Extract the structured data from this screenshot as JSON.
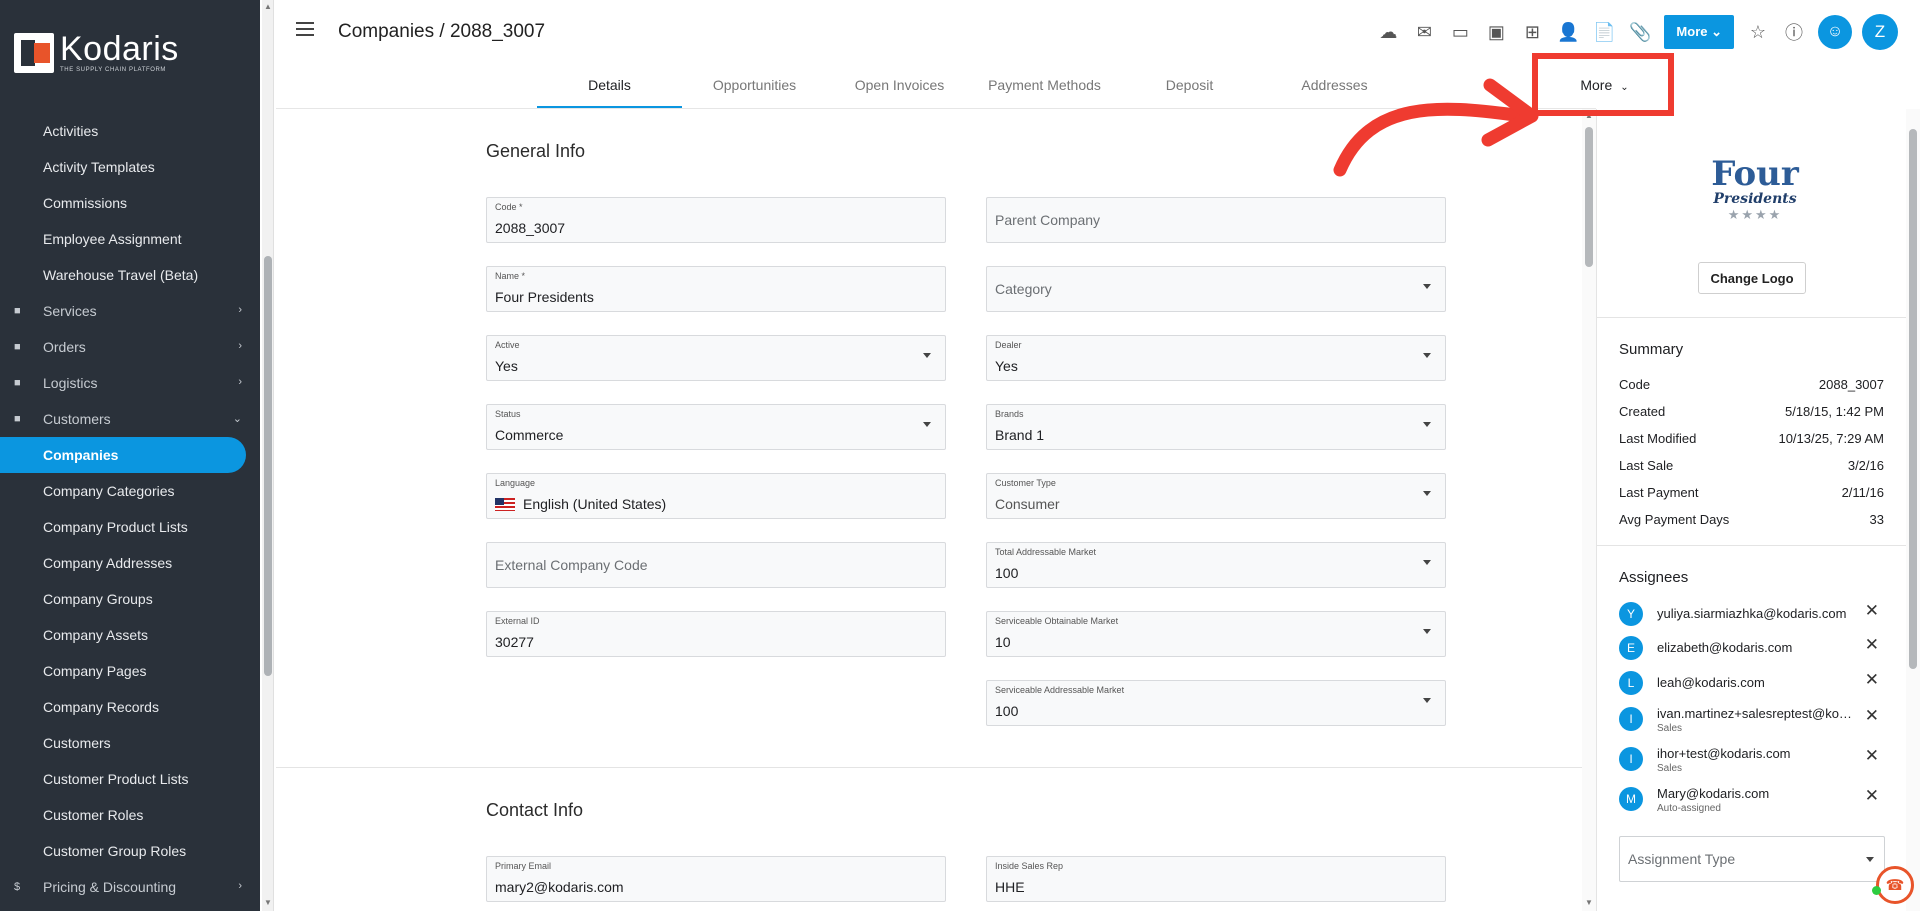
{
  "brand": {
    "name": "Kodaris",
    "tagline": "THE SUPPLY CHAIN PLATFORM"
  },
  "sidebar": {
    "items": [
      {
        "label": "Activities",
        "type": "sub"
      },
      {
        "label": "Activity Templates",
        "type": "sub"
      },
      {
        "label": "Commissions",
        "type": "sub"
      },
      {
        "label": "Employee Assignment",
        "type": "sub"
      },
      {
        "label": "Warehouse Travel (Beta)",
        "type": "sub"
      },
      {
        "label": "Services",
        "type": "group",
        "icon": "gears-icon"
      },
      {
        "label": "Orders",
        "type": "group",
        "icon": "truck-icon"
      },
      {
        "label": "Logistics",
        "type": "group",
        "icon": "shipping-icon"
      },
      {
        "label": "Customers",
        "type": "group",
        "icon": "people-icon"
      },
      {
        "label": "Companies",
        "type": "active"
      },
      {
        "label": "Company Categories",
        "type": "sub"
      },
      {
        "label": "Company Product Lists",
        "type": "sub"
      },
      {
        "label": "Company Addresses",
        "type": "sub"
      },
      {
        "label": "Company Groups",
        "type": "sub"
      },
      {
        "label": "Company Assets",
        "type": "sub"
      },
      {
        "label": "Company Pages",
        "type": "sub"
      },
      {
        "label": "Company Records",
        "type": "sub"
      },
      {
        "label": "Customers",
        "type": "sub"
      },
      {
        "label": "Customer Product Lists",
        "type": "sub"
      },
      {
        "label": "Customer Roles",
        "type": "sub"
      },
      {
        "label": "Customer Group Roles",
        "type": "sub"
      },
      {
        "label": "Pricing & Discounting",
        "type": "group",
        "icon": "dollar-icon"
      }
    ]
  },
  "header": {
    "title": "Companies / 2088_3007",
    "more_label": "More",
    "avatar_letter": "Z"
  },
  "tabs": [
    "Details",
    "Opportunities",
    "Open Invoices",
    "Payment Methods",
    "Deposit",
    "Addresses"
  ],
  "tab_more": "More",
  "general_info": {
    "title": "General Info",
    "code": {
      "label": "Code *",
      "value": "2088_3007"
    },
    "parent_company": {
      "placeholder": "Parent Company"
    },
    "name": {
      "label": "Name *",
      "value": "Four Presidents"
    },
    "category": {
      "placeholder": "Category"
    },
    "active": {
      "label": "Active",
      "value": "Yes"
    },
    "dealer": {
      "label": "Dealer",
      "value": "Yes"
    },
    "status": {
      "label": "Status",
      "value": "Commerce"
    },
    "brands": {
      "label": "Brands",
      "value": "Brand 1"
    },
    "language": {
      "label": "Language",
      "value": "English (United States)"
    },
    "customer_type": {
      "label": "Customer Type",
      "value": "Consumer"
    },
    "external_company_code": {
      "placeholder": "External Company Code"
    },
    "tam": {
      "label": "Total Addressable Market",
      "value": "100"
    },
    "external_id": {
      "label": "External ID",
      "value": "30277"
    },
    "som": {
      "label": "Serviceable Obtainable Market",
      "value": "10"
    },
    "sam": {
      "label": "Serviceable Addressable Market",
      "value": "100"
    }
  },
  "contact_info": {
    "title": "Contact Info",
    "primary_email": {
      "label": "Primary Email",
      "value": "mary2@kodaris.com"
    },
    "inside_sales_rep": {
      "label": "Inside Sales Rep",
      "value": "HHE"
    }
  },
  "right_panel": {
    "logo": {
      "line1": "Four",
      "line2": "Presidents",
      "stars": "★★★★"
    },
    "change_logo": "Change Logo",
    "summary_title": "Summary",
    "summary": [
      {
        "label": "Code",
        "value": "2088_3007"
      },
      {
        "label": "Created",
        "value": "5/18/15, 1:42 PM"
      },
      {
        "label": "Last Modified",
        "value": "10/13/25, 7:29 AM"
      },
      {
        "label": "Last Sale",
        "value": "3/2/16"
      },
      {
        "label": "Last Payment",
        "value": "2/11/16"
      },
      {
        "label": "Avg Payment Days",
        "value": "33"
      }
    ],
    "assignees_title": "Assignees",
    "assignees": [
      {
        "letter": "Y",
        "email": "yuliya.siarmiazhka@kodaris.com",
        "sub": ""
      },
      {
        "letter": "E",
        "email": "elizabeth@kodaris.com",
        "sub": ""
      },
      {
        "letter": "L",
        "email": "leah@kodaris.com",
        "sub": ""
      },
      {
        "letter": "I",
        "email": "ivan.martinez+salesreptest@kodaris.com",
        "sub": "Sales"
      },
      {
        "letter": "I",
        "email": "ihor+test@kodaris.com",
        "sub": "Sales"
      },
      {
        "letter": "M",
        "email": "Mary@kodaris.com",
        "sub": "Auto-assigned"
      }
    ],
    "assignment_type": {
      "placeholder": "Assignment Type"
    }
  },
  "colors": {
    "accent": "#0b96e0",
    "sidebar_bg": "#2a313a",
    "highlight": "#ef3b30"
  }
}
